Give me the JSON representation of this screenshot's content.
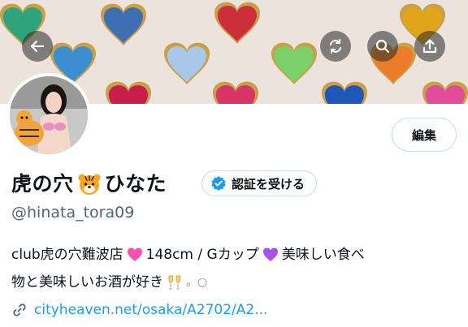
{
  "colors": {
    "accent": "#1d9bf0",
    "handle_gray": "#536471",
    "heart_emoji": "#ff4fb0",
    "purple_heart": "#a555ee"
  },
  "header": {
    "back_icon": "back-arrow-icon",
    "refresh_icon": "refresh-icon",
    "search_icon": "search-icon",
    "share_icon": "share-icon"
  },
  "profile": {
    "display_name_part1": "虎の穴",
    "display_name_part2": "ひなた",
    "verify_label": "認証を受ける",
    "handle": "@hinata_tora09",
    "edit_label": "編集"
  },
  "bio": {
    "segment1": "club虎の穴難波店",
    "segment2": "148cm / Gカップ",
    "segment3": "美味しい食べ",
    "segment4": "物と美味しいお酒が好き",
    "segment5": "。○"
  },
  "link": {
    "text": "cityheaven.net/osaka/A2702/A2..."
  }
}
